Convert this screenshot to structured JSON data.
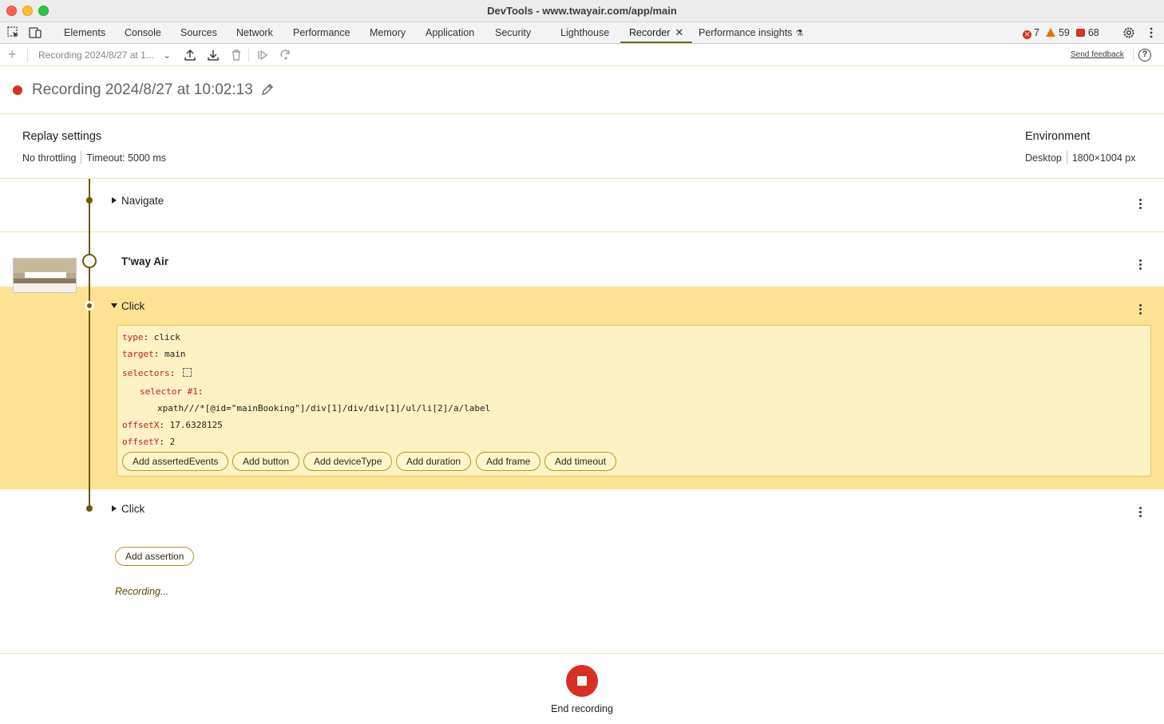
{
  "window": {
    "title": "DevTools - www.twayair.com/app/main"
  },
  "tabs": [
    {
      "label": "Elements"
    },
    {
      "label": "Console"
    },
    {
      "label": "Sources"
    },
    {
      "label": "Network"
    },
    {
      "label": "Performance"
    },
    {
      "label": "Memory"
    },
    {
      "label": "Application"
    },
    {
      "label": "Security"
    },
    {
      "label": "Lighthouse"
    },
    {
      "label": "Recorder",
      "active": true
    },
    {
      "label": "Performance insights"
    }
  ],
  "status_counts": {
    "errors": "7",
    "warnings": "59",
    "messages": "68"
  },
  "toolbar": {
    "recording_select": "Recording 2024/8/27 at 1...",
    "send_feedback": "Send feedback"
  },
  "recording": {
    "title": "Recording 2024/8/27 at 10:02:13"
  },
  "replay_settings": {
    "heading": "Replay settings",
    "throttling": "No throttling",
    "timeout": "Timeout: 5000 ms"
  },
  "environment": {
    "heading": "Environment",
    "device": "Desktop",
    "viewport": "1800×1004 px"
  },
  "steps": [
    {
      "title": "Navigate"
    },
    {
      "title": "T'way Air"
    },
    {
      "title": "Click"
    },
    {
      "title": "Click"
    }
  ],
  "selected_step": {
    "type_key": "type",
    "type_val": "click",
    "target_key": "target",
    "target_val": "main",
    "selectors_key": "selectors",
    "selector1_key": "selector #1",
    "selector1_val": "xpath///*[@id=\"mainBooking\"]/div[1]/div/div[1]/ul/li[2]/a/label",
    "offsetX_key": "offsetX",
    "offsetX_val": "17.6328125",
    "offsetY_key": "offsetY",
    "offsetY_val": "2",
    "add_buttons": [
      "Add assertedEvents",
      "Add button",
      "Add deviceType",
      "Add duration",
      "Add frame",
      "Add timeout"
    ]
  },
  "add_assertion": "Add assertion",
  "recording_status": "Recording...",
  "end_recording": "End recording",
  "colors": {
    "accent": "#6b5a00",
    "selected_band": "#fde293",
    "record_red": "#d93025"
  }
}
